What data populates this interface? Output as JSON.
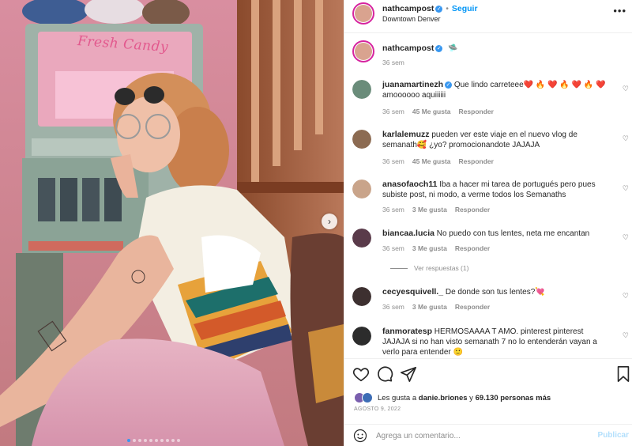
{
  "photo": {
    "sign_text": "Fresh Candy",
    "carousel_total": 10,
    "carousel_active": 0,
    "next_icon": "chevron-right-icon"
  },
  "header": {
    "username": "nathcampost",
    "separator": "•",
    "follow_label": "Seguir",
    "location": "Downtown Denver",
    "more_icon": "more-options-icon"
  },
  "caption": {
    "username": "nathcampost",
    "text": "🛸",
    "time": "36 sem"
  },
  "comments": [
    {
      "username": "juanamartinezh",
      "verified": true,
      "text": "Que lindo carreteee❤️ 🔥 ❤️ 🔥 ❤️ 🔥 ❤️ amoooooo aquiiiiii",
      "time": "36 sem",
      "likes": "45 Me gusta",
      "reply": "Responder",
      "avatar_color": "#6a8c7a"
    },
    {
      "username": "karlalemuzz",
      "verified": false,
      "text": "pueden ver este viaje en el nuevo vlog de semanath🥰 ¿yo? promocionandote JAJAJA",
      "time": "36 sem",
      "likes": "45 Me gusta",
      "reply": "Responder",
      "avatar_color": "#8c6b52"
    },
    {
      "username": "anasofaoch11",
      "verified": false,
      "text": "Iba a hacer mi tarea de portugués pero pues subiste post, ni modo, a verme todos los Semanaths",
      "time": "36 sem",
      "likes": "3 Me gusta",
      "reply": "Responder",
      "avatar_color": "#c9a48a"
    },
    {
      "username": "biancaa.lucia",
      "verified": false,
      "text": "No puedo con tus lentes, neta me encantan",
      "time": "36 sem",
      "likes": "3 Me gusta",
      "reply": "Responder",
      "avatar_color": "#5a3b4a",
      "replies": "Ver respuestas (1)"
    },
    {
      "username": "cecyesquivell._",
      "verified": false,
      "text": "De donde son tus lentes?💘",
      "time": "36 sem",
      "likes": "3 Me gusta",
      "reply": "Responder",
      "avatar_color": "#3d3030"
    },
    {
      "username": "fanmoratesp",
      "verified": false,
      "text": "HERMOSAAAA T AMO. pinterest pinterest JAJAJA si no han visto semanath 7 no lo entenderán vayan a verlo para entender 🙂",
      "time": "36 sem",
      "likes": "",
      "reply": "",
      "avatar_color": "#2c2c2c"
    }
  ],
  "actions": {
    "like_icon": "heart-icon",
    "comment_icon": "comment-icon",
    "share_icon": "share-icon",
    "save_icon": "bookmark-icon"
  },
  "likes": {
    "prefix": "Les gusta a",
    "first_user": "danie.briones",
    "conjunction": "y",
    "others": "69.130 personas más"
  },
  "date": "AGOSTO 9, 2022",
  "add_comment": {
    "placeholder": "Agrega un comentario...",
    "publish_label": "Publicar",
    "emoji_icon": "emoji-icon"
  },
  "colors": {
    "accent": "#0095f6",
    "verified": "#3897f0",
    "muted": "#8e8e8e",
    "publish_disabled": "#b2dffc"
  }
}
